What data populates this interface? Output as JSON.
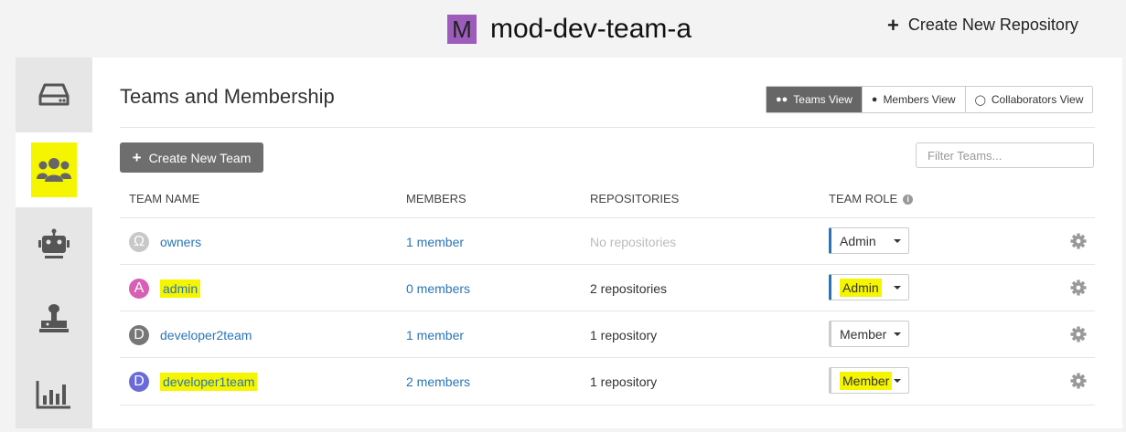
{
  "header": {
    "org_initial": "M",
    "org_name": "mod-dev-team-a",
    "create_repo_label": "Create New Repository",
    "avatar_color": "#9d5cbb"
  },
  "sidebar": {
    "items": [
      {
        "icon": "repository-icon"
      },
      {
        "icon": "teams-icon",
        "active": true
      },
      {
        "icon": "robot-icon"
      },
      {
        "icon": "joystick-icon"
      },
      {
        "icon": "usage-chart-icon"
      }
    ]
  },
  "main": {
    "title": "Teams and Membership",
    "views": [
      "Teams View",
      "Members View",
      "Collaborators View"
    ],
    "create_team_label": "Create New Team",
    "filter_placeholder": "Filter Teams...",
    "columns": [
      "TEAM NAME",
      "MEMBERS",
      "REPOSITORIES",
      "TEAM ROLE"
    ],
    "teams": [
      {
        "initial": "Ω",
        "name": "owners",
        "members": "1 member",
        "repositories": "No repositories",
        "role": "Admin",
        "avatar_color": "#c8c8c8"
      },
      {
        "initial": "A",
        "name": "admin",
        "members": "0 members",
        "repositories": "2 repositories",
        "role": "Admin",
        "avatar_color": "#d85fb4"
      },
      {
        "initial": "D",
        "name": "developer2team",
        "members": "1 member",
        "repositories": "1 repository",
        "role": "Member",
        "avatar_color": "#777777"
      },
      {
        "initial": "D",
        "name": "developer1team",
        "members": "2 members",
        "repositories": "1 repository",
        "role": "Member",
        "avatar_color": "#6a6ad8"
      }
    ]
  },
  "colors": {
    "link": "#2a75b8",
    "highlight": "#f5f500",
    "accent": "#2a75b8"
  }
}
